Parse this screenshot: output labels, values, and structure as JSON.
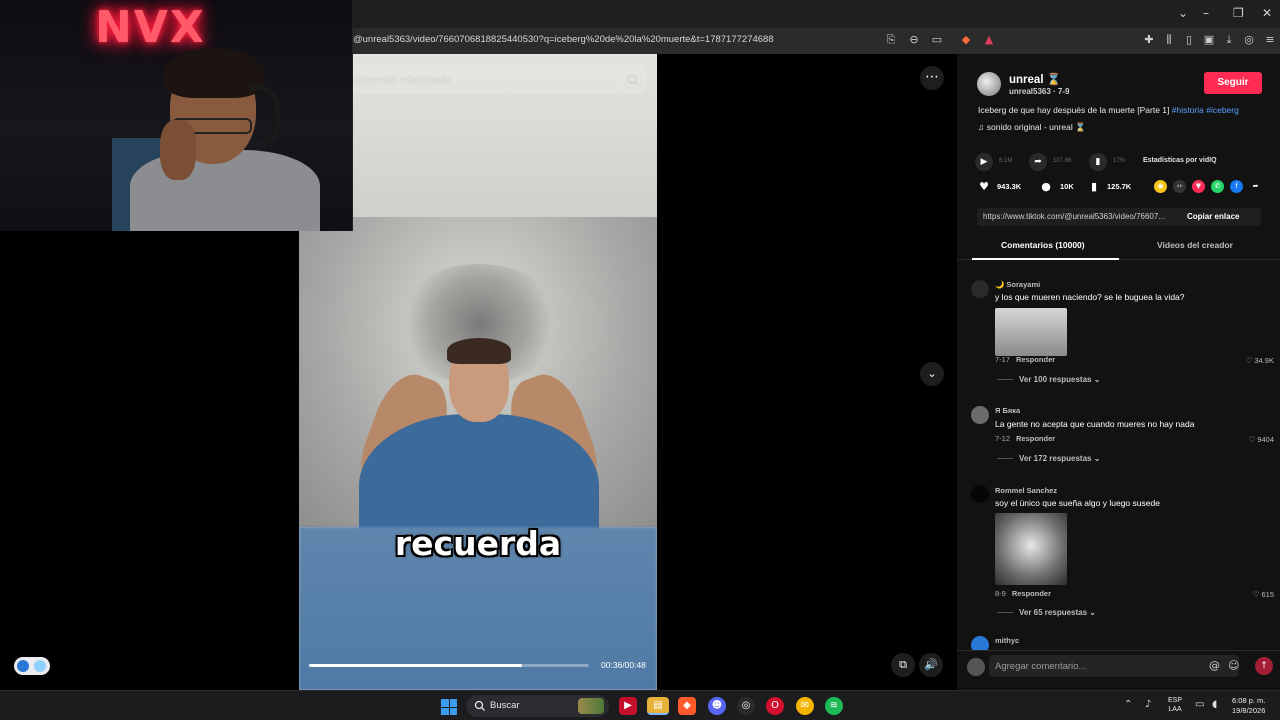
{
  "browser": {
    "url": "@unreal5363/video/7660706818825440530?q=iceberg%20de%20la%20muerte&t=1787177274688"
  },
  "webcam": {
    "neon_sign": "NVX"
  },
  "search": {
    "placeholder": "contenido relacionado"
  },
  "video": {
    "caption": "recuerda",
    "time": "00:36/00:48",
    "progress": 0.76
  },
  "creator": {
    "name": "unreal ⌛",
    "handle_date": "unreal5363 · 7-9",
    "follow_label": "Seguir",
    "description": "Iceberg de que hay después de la muerte [Parte 1]",
    "hashtags": "#historia #iceberg",
    "sound": "♫  sonido original - unreal ⌛"
  },
  "stats": {
    "vidiq_label": "Estadísticas por vidIQ",
    "views_faint": "6.1M",
    "shares_faint": "107.6K",
    "engagement_faint": "17%",
    "likes": "943.3K",
    "comments": "10K",
    "saves": "125.7K"
  },
  "link": {
    "url": "https://www.tiktok.com/@unreal5363/video/76607...",
    "copy_label": "Copiar enlace"
  },
  "tabs": {
    "comments": "Comentarios (10000)",
    "creator_videos": "Videos del creador"
  },
  "comments": [
    {
      "user": "🌙 Sorayami",
      "text": "y los que mueren naciendo? se le buguea la vida?",
      "date": "7-17",
      "reply": "Responder",
      "likes": "♡ 34.9K",
      "replies": "Ver 100 respuestas ⌄"
    },
    {
      "user": "Я Бяка",
      "text": "La gente no acepta que cuando mueres no hay nada",
      "date": "7-12",
      "reply": "Responder",
      "likes": "♡ 9404",
      "replies": "Ver 172 respuestas ⌄"
    },
    {
      "user": "Rommel Sanchez",
      "text": "soy el único que sueña algo y luego susede",
      "date": "8-9",
      "reply": "Responder",
      "likes": "♡ 615",
      "replies": "Ver 65 respuestas ⌄"
    },
    {
      "user": "mithyc"
    }
  ],
  "comment_input": {
    "placeholder": "Agregar comentario..."
  },
  "taskbar": {
    "search_label": "Buscar",
    "lang_top": "ESP",
    "lang_bottom": "LAA",
    "time": "6:08 p. m.",
    "date": "19/8/2026"
  },
  "colors": {
    "accent": "#fe2c55",
    "hashtag": "#5aa0ff",
    "panel_bg": "#121212"
  }
}
